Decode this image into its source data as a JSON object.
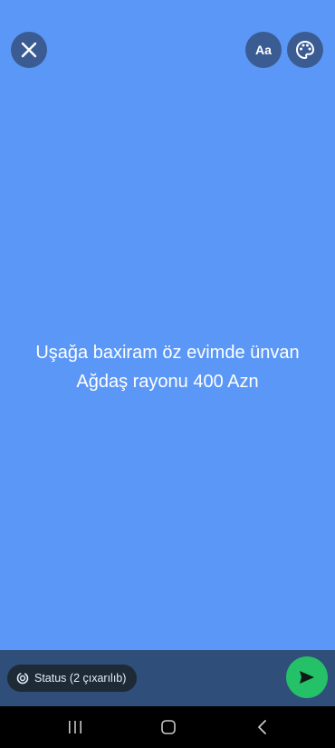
{
  "colors": {
    "background": "#5b97f7",
    "top_button": "#3a5c93",
    "bottom_bar": "#2f4e79",
    "chip": "#1e2a35",
    "send": "#25c168",
    "nav_bar": "#000000"
  },
  "toolbar": {
    "close_icon": "close-icon",
    "font_label": "Aa",
    "palette_icon": "palette-icon"
  },
  "status": {
    "text": "Uşağa baxiram öz evimde ünvan Ağdaş rayonu 400 Azn"
  },
  "composer": {
    "audience_icon": "status-ring-icon",
    "audience_label": "Status (2 çıxarılıb)",
    "send_icon": "send-icon"
  },
  "nav": {
    "recents_icon": "recents-icon",
    "home_icon": "home-icon",
    "back_icon": "back-icon"
  }
}
